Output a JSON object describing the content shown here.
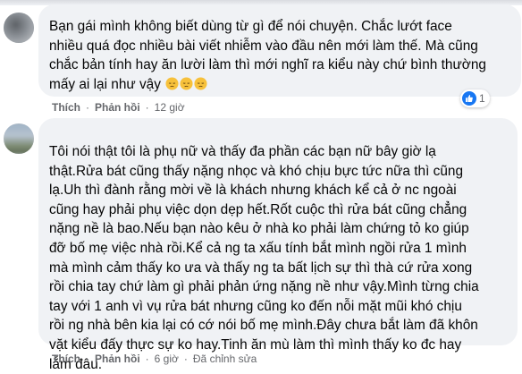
{
  "comment1": {
    "line1": "Bạn gái mình không biết dùng từ gì để nói chuyện. Chắc lướt face",
    "line2": "nhiều quá đọc nhiều bài viết nhiễm vào đầu nên mới làm thế. Mà cũng",
    "line3": "chắc bản tính hay ăn lười làm thì mới nghĩ ra kiểu này chứ bình thường",
    "line4": "mấy ai lại như vậy",
    "reaction_count": "1",
    "like_label": "Thích",
    "reply_label": "Phản hồi",
    "time": "12 giờ"
  },
  "comment2": {
    "lines": [
      "Tôi nói thật tôi là phụ nữ và thấy đa phần các bạn nữ bây giờ lạ",
      "thật.Rửa bát cũng thấy nặng nhọc và khó chịu bực tức nữa thì cũng",
      "lạ.Uh thì đành rằng mời về là khách nhưng khách kể cả ở nc ngoài",
      "cũng hay phải phụ việc dọn dẹp hết.Rốt cuộc thì rửa bát cũng chẳng",
      "nặng nề là bao.Nếu bạn nào kêu ở nhà ko phải làm chứng tỏ ko giúp",
      "đỡ bố mẹ việc nhà rồi.Kể cả ng ta xấu tính bắt mình ngồi rửa 1 mình",
      "mà mình cảm thấy ko ưa và thấy ng ta bất lịch sự thì thà cứ rửa xong",
      "rồi chia tay chứ làm gì phải phản ứng nặng nề như vậy.Mình từng chia",
      "tay với 1 anh vì vụ rửa bát nhưng cũng ko đến nỗi mặt mũi khó chịu",
      "rồi ng nhà bên kia lại có cớ nói bố mẹ mình.Đây chưa bắt làm đã khôn",
      "vặt kiểu đấy thực sự ko hay.Tinh ăn mù làm thì mình thấy ko đc hay",
      "lắm đâu."
    ],
    "like_label": "Thích",
    "reply_label": "Phản hồi",
    "time": "6 giờ",
    "edited": "Đã chỉnh sửa"
  },
  "colors": {
    "bubble": "#f0f2f5",
    "secondary_text": "#65676b",
    "like_blue": "#1877f2"
  }
}
